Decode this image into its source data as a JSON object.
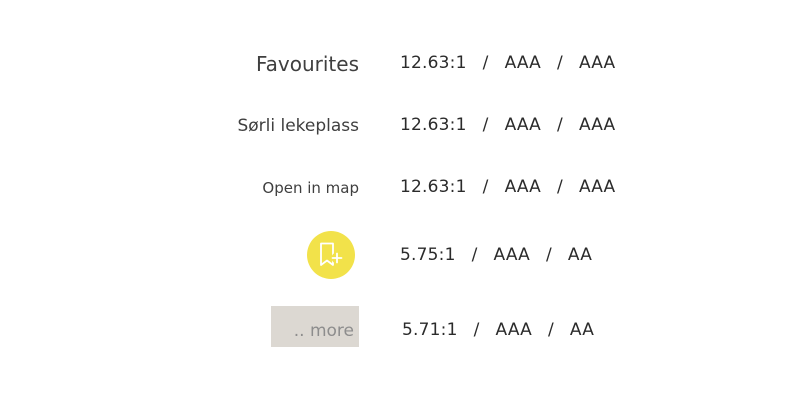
{
  "rows": [
    {
      "sample_label": "Favourites",
      "ratio": "12.63:1",
      "aa_level": "AAA",
      "aaa_level": "AAA"
    },
    {
      "sample_label": "Sørli lekeplass",
      "ratio": "12.63:1",
      "aa_level": "AAA",
      "aaa_level": "AAA"
    },
    {
      "sample_label": "Open in map",
      "ratio": "12.63:1",
      "aa_level": "AAA",
      "aaa_level": "AAA"
    },
    {
      "sample_icon": "bookmark-plus-icon",
      "ratio": "5.75:1",
      "aa_level": "AAA",
      "aaa_level": "AA"
    },
    {
      "sample_label": ".. more",
      "ratio": "5.71:1",
      "aa_level": "AAA",
      "aaa_level": "AA"
    }
  ],
  "separator": "/",
  "colors": {
    "badge_background": "#f2e24a",
    "more_background": "#dcd8d2",
    "more_text": "#8d8d8d",
    "text": "#3f3f3f"
  }
}
